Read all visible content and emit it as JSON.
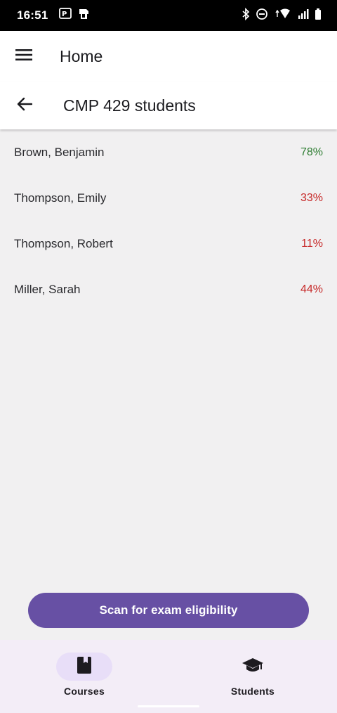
{
  "status_bar": {
    "time": "16:51",
    "left_icons": [
      "p-icon",
      "sim-notification-icon"
    ],
    "right_icons": [
      "bluetooth-icon",
      "do-not-disturb-icon",
      "wifi-icon",
      "signal-icon",
      "battery-icon"
    ]
  },
  "app_bar": {
    "title": "Home",
    "menu_icon": "hamburger-menu-icon"
  },
  "sub_header": {
    "title": "CMP 429 students",
    "back_icon": "arrow-back-icon"
  },
  "students": [
    {
      "name": "Brown, Benjamin",
      "percent": "78%",
      "color": "#2e7d32"
    },
    {
      "name": "Thompson, Emily",
      "percent": "33%",
      "color": "#c62828"
    },
    {
      "name": "Thompson, Robert",
      "percent": "11%",
      "color": "#c62828"
    },
    {
      "name": "Miller, Sarah",
      "percent": "44%",
      "color": "#c62828"
    }
  ],
  "scan_button": {
    "label": "Scan for exam eligibility",
    "color": "#6750a4"
  },
  "bottom_nav": {
    "items": [
      {
        "label": "Courses",
        "icon": "book-icon",
        "active": true
      },
      {
        "label": "Students",
        "icon": "graduation-cap-icon",
        "active": false
      }
    ],
    "active_pill_color": "#e8def8"
  }
}
